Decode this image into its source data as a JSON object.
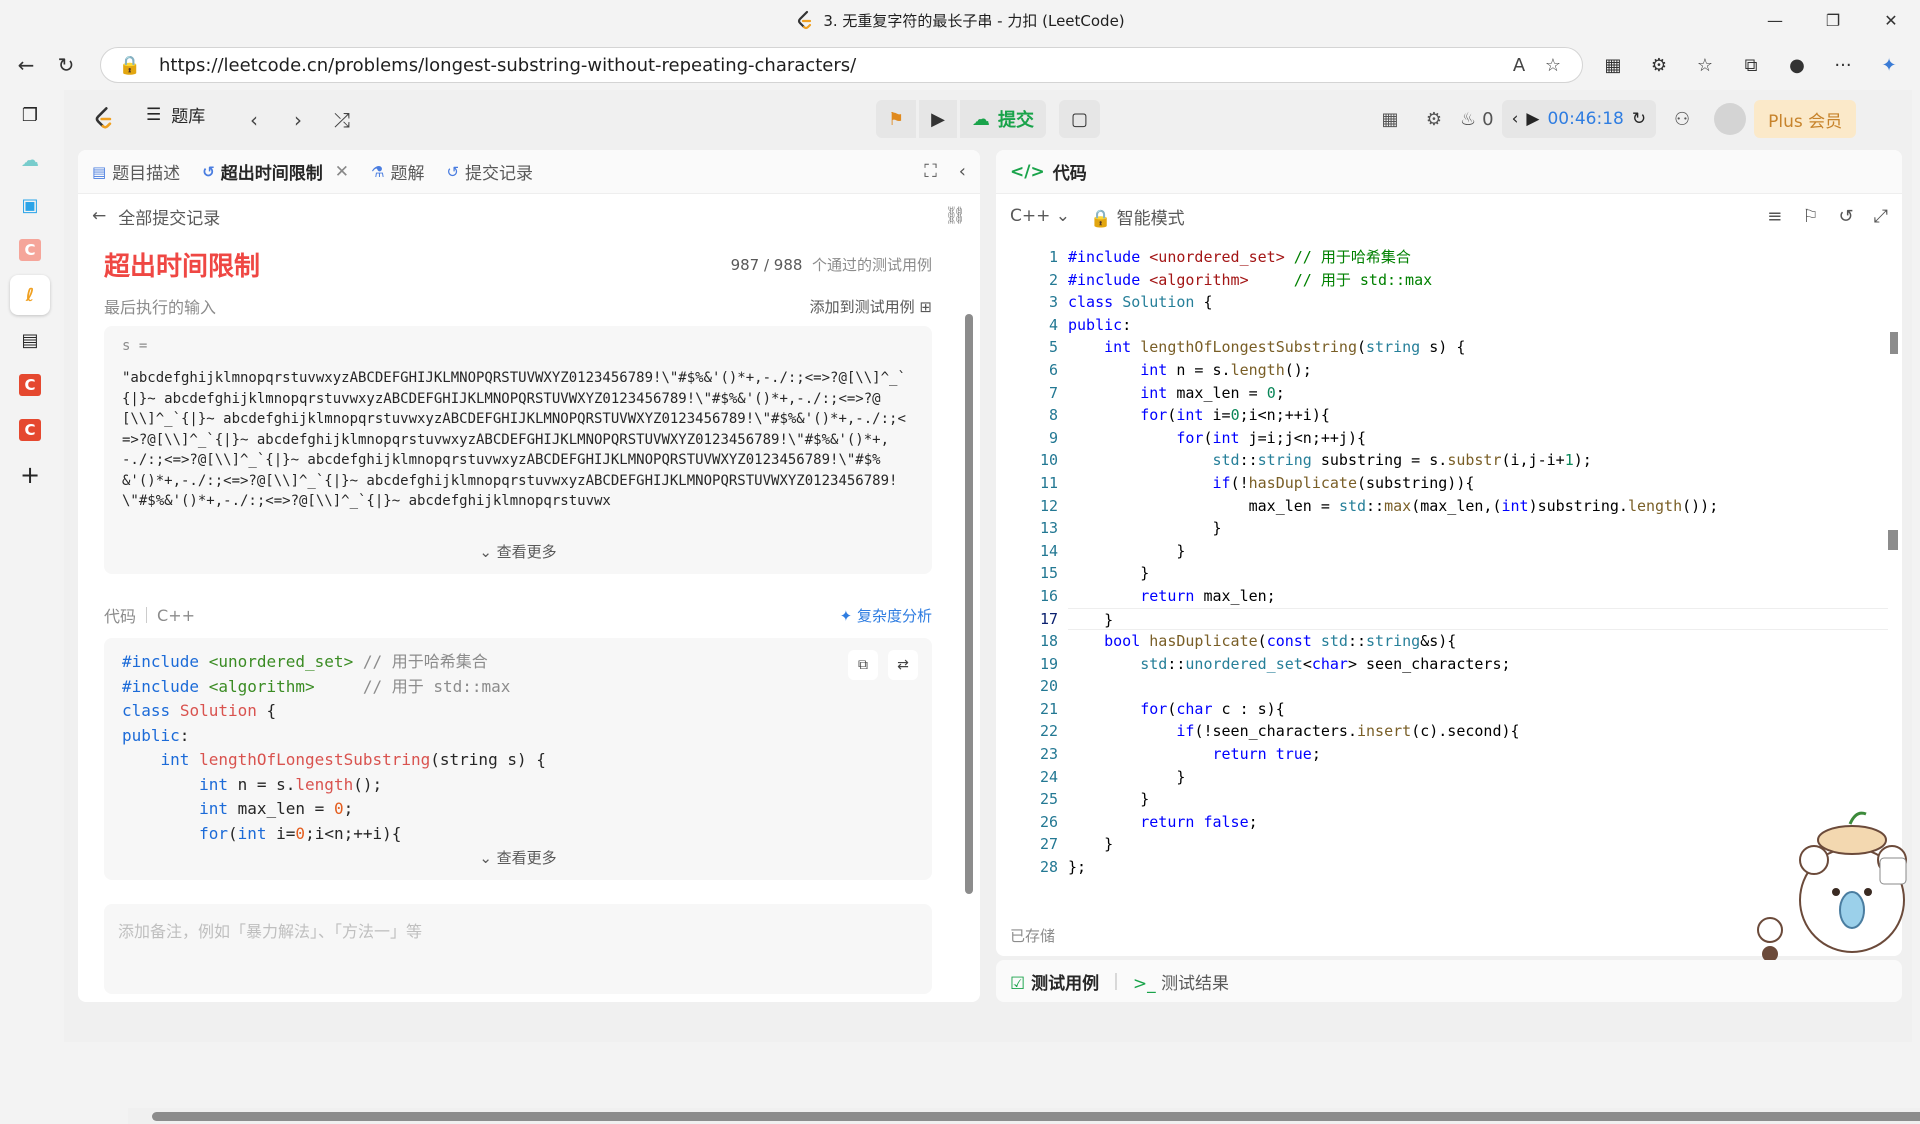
{
  "window": {
    "title": "3. 无重复字符的最长子串 - 力扣 (LeetCode)",
    "controls": [
      "—",
      "❐",
      "✕"
    ]
  },
  "browser": {
    "url": "https://leetcode.cn/problems/longest-substring-without-repeating-characters/"
  },
  "header": {
    "problem_list": "题库",
    "submit_label": "提交",
    "fire_count": "0",
    "timer": "00:46:18",
    "plus_label": "Plus 会员"
  },
  "left_panel": {
    "tabs": [
      {
        "label": "题目描述"
      },
      {
        "label": "超出时间限制"
      },
      {
        "label": "题解"
      },
      {
        "label": "提交记录"
      }
    ],
    "back_label": "全部提交记录",
    "result_title": "超出时间限制",
    "passed": "987 / 988",
    "passed_suffix": "个通过的测试用例",
    "last_input_label": "最后执行的输入",
    "add_testcase": "添加到测试用例",
    "input_var": "s =",
    "input_value": "\"abcdefghijklmnopqrstuvwxyzABCDEFGHIJKLMNOPQRSTUVWXYZ0123456789!\\\"#$%&'()*+,-./:;<=>?@[\\\\]^_`{|}~ abcdefghijklmnopqrstuvwxyzABCDEFGHIJKLMNOPQRSTUVWXYZ0123456789!\\\"#$%&'()*+,-./:;<=>?@[\\\\]^_`{|}~ abcdefghijklmnopqrstuvwxyzABCDEFGHIJKLMNOPQRSTUVWXYZ0123456789!\\\"#$%&'()*+,-./:;<=>?@[\\\\]^_`{|}~ abcdefghijklmnopqrstuvwxyzABCDEFGHIJKLMNOPQRSTUVWXYZ0123456789!\\\"#$%&'()*+,-./:;<=>?@[\\\\]^_`{|}~ abcdefghijklmnopqrstuvwxyzABCDEFGHIJKLMNOPQRSTUVWXYZ0123456789!\\\"#$%&'()*+,-./:;<=>?@[\\\\]^_`{|}~ abcdefghijklmnopqrstuvwxyzABCDEFGHIJKLMNOPQRSTUVWXYZ0123456789!\\\"#$%&'()*+,-./:;<=>?@[\\\\]^_`{|}~ abcdefghijklmnopqrstuvwx",
    "see_more": "查看更多",
    "code_label": "代码",
    "code_lang": "C++",
    "complexity": "复杂度分析",
    "code_preview": [
      "#include <unordered_set> // 用于哈希集合",
      "#include <algorithm>     // 用于 std::max",
      "class Solution {",
      "public:",
      "    int lengthOfLongestSubstring(string s) {",
      "        int n = s.length();",
      "        int max_len = 0;",
      "        for(int i=0;i<n;++i){"
    ],
    "note_placeholder": "添加备注，例如「暴力解法」、「方法一」等"
  },
  "right_panel": {
    "title": "代码",
    "language": "C++",
    "mode": "智能模式",
    "saved": "已存储",
    "code": [
      "#include <unordered_set> // 用于哈希集合",
      "#include <algorithm>     // 用于 std::max",
      "class Solution {",
      "public:",
      "    int lengthOfLongestSubstring(string s) {",
      "        int n = s.length();",
      "        int max_len = 0;",
      "        for(int i=0;i<n;++i){",
      "            for(int j=i;j<n;++j){",
      "                std::string substring = s.substr(i,j-i+1);",
      "                if(!hasDuplicate(substring)){",
      "                    max_len = std::max(max_len,(int)substring.length());",
      "                }",
      "            }",
      "        }",
      "        return max_len;",
      "    }",
      "    bool hasDuplicate(const std::string&s){",
      "        std::unordered_set<char> seen_characters;",
      "",
      "        for(char c : s){",
      "            if(!seen_characters.insert(c).second){",
      "                return true;",
      "            }",
      "        }",
      "        return false;",
      "    }",
      "};"
    ],
    "current_line": 17
  },
  "test_panel": {
    "tab1": "测试用例",
    "tab2": "测试结果"
  },
  "colors": {
    "error_red": "#ef4743",
    "submit_green": "#19a34a",
    "timer_blue": "#2f7de1",
    "plus_gold": "#c7832b"
  }
}
